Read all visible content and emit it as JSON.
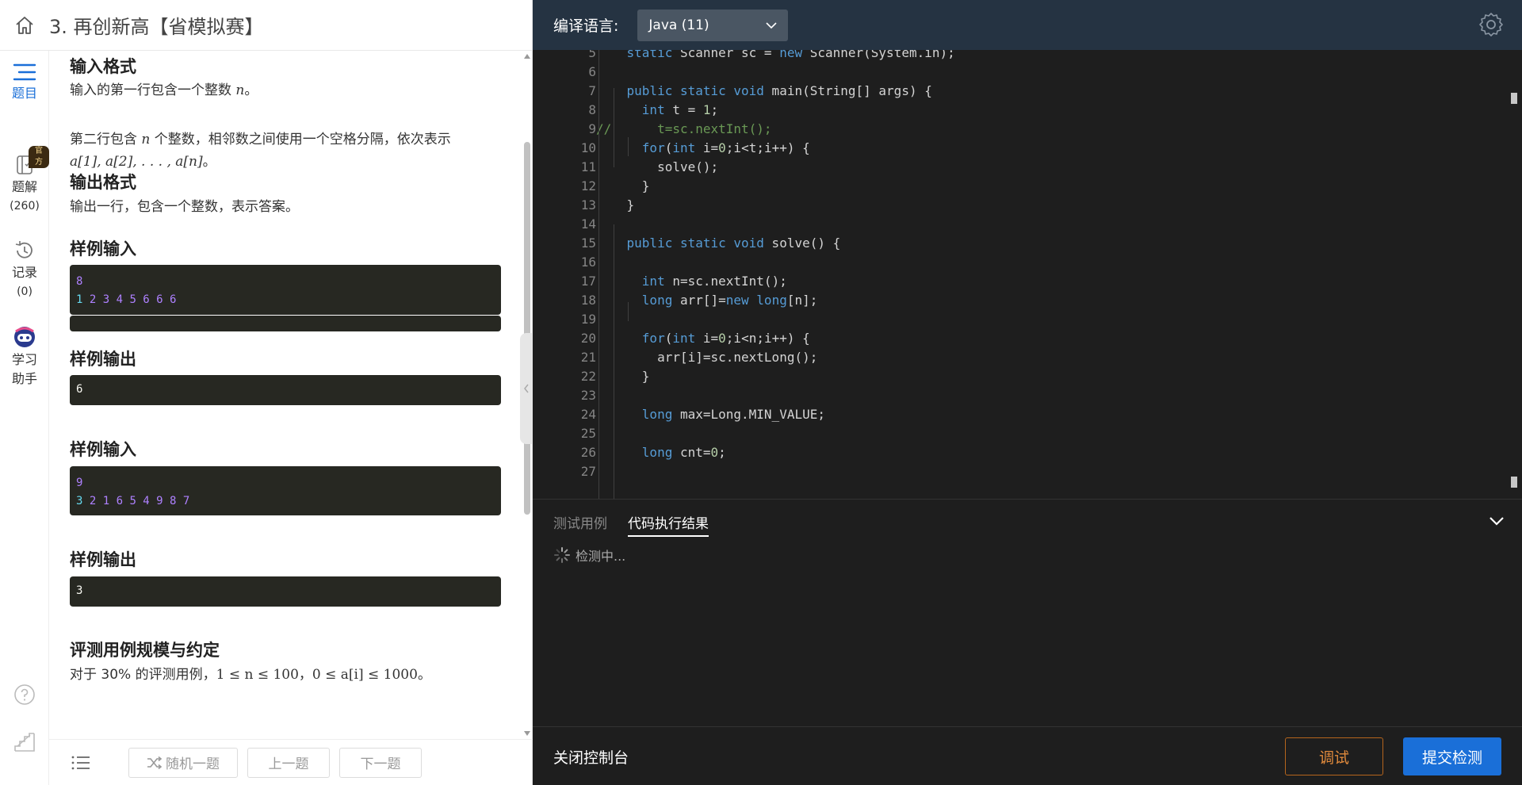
{
  "problem": {
    "title": "3. 再创新高【省模拟赛】"
  },
  "rail": {
    "problem_label": "题目",
    "solutions_label": "题解",
    "solutions_count": "(260)",
    "official_badge": "官方",
    "records_label": "记录",
    "records_count": "(0)",
    "assistant_line1": "学习",
    "assistant_line2": "助手"
  },
  "statement": {
    "input_format_h": "输入格式",
    "input_line1_prefix": "输入的第一行包含一个整数 ",
    "input_line1_var": "n",
    "input_line1_suffix": "。",
    "input_line2_prefix": "第二行包含 ",
    "input_line2_var": "n",
    "input_line2_suffix": " 个整数，相邻数之间使用一个空格分隔，依次表示",
    "input_line2_math": "a[1], a[2], . . . , a[n]",
    "input_line2_end": "。",
    "output_format_h": "输出格式",
    "output_text": "输出一行，包含一个整数，表示答案。",
    "sample_input_h": "样例输入",
    "sample_output_h": "样例输出",
    "samples": [
      {
        "input_l1": "8",
        "input_l2_first": "1",
        "input_l2_rest": " 2 3 4 5 6 6 6",
        "output": "6"
      },
      {
        "input_l1": "9",
        "input_l2_first": "3",
        "input_l2_rest": " 2 1 6 5 4 9 8 7",
        "output": "3"
      }
    ],
    "constraints_h": "评测用例规模与约定",
    "constraints_prefix": "对于 30% 的评测用例，",
    "constraints_math1": "1 ≤ n ≤ 100",
    "constraints_sep": "，",
    "constraints_math2": "0 ≤ a[i] ≤ 1000",
    "constraints_end": "。"
  },
  "footer": {
    "random_btn": "随机一题",
    "prev_btn": "上一题",
    "next_btn": "下一题"
  },
  "editor": {
    "lang_label": "编译语言:",
    "lang_value": "Java (11)",
    "lines": [
      {
        "n": "5",
        "html": "    <span class=\"kw\">static</span> Scanner sc = <span class=\"kw\">new</span> Scanner(System.in);"
      },
      {
        "n": "6",
        "html": ""
      },
      {
        "n": "7",
        "html": "    <span class=\"kw\">public static void</span> main(String[] args) {"
      },
      {
        "n": "8",
        "html": "      <span class=\"kw\">int</span> t = <span class=\"num\">1</span>;"
      },
      {
        "n": "9",
        "html": "<span class=\"cm\">//      t=sc.nextInt();</span>"
      },
      {
        "n": "10",
        "html": "      <span class=\"kw\">for</span>(<span class=\"kw\">int</span> i=<span class=\"num\">0</span>;i&lt;t;i++) {"
      },
      {
        "n": "11",
        "html": "        solve();"
      },
      {
        "n": "12",
        "html": "      }"
      },
      {
        "n": "13",
        "html": "    }"
      },
      {
        "n": "14",
        "html": ""
      },
      {
        "n": "15",
        "html": "    <span class=\"kw\">public static void</span> solve() {"
      },
      {
        "n": "16",
        "html": ""
      },
      {
        "n": "17",
        "html": "      <span class=\"kw\">int</span> n=sc.nextInt();"
      },
      {
        "n": "18",
        "html": "      <span class=\"kw\">long</span> arr[]=<span class=\"kw\">new long</span>[n];"
      },
      {
        "n": "19",
        "html": ""
      },
      {
        "n": "20",
        "html": "      <span class=\"kw\">for</span>(<span class=\"kw\">int</span> i=<span class=\"num\">0</span>;i&lt;n;i++) {"
      },
      {
        "n": "21",
        "html": "        arr[i]=sc.nextLong();"
      },
      {
        "n": "22",
        "html": "      }"
      },
      {
        "n": "23",
        "html": ""
      },
      {
        "n": "24",
        "html": "      <span class=\"kw\">long</span> max=Long.MIN_VALUE;"
      },
      {
        "n": "25",
        "html": ""
      },
      {
        "n": "26",
        "html": "      <span class=\"kw\">long</span> cnt=<span class=\"num\">0</span>;"
      },
      {
        "n": "27",
        "html": ""
      }
    ]
  },
  "console": {
    "tab_testcase": "测试用例",
    "tab_result": "代码执行结果",
    "status_text": "检测中..."
  },
  "actions": {
    "close_console": "关闭控制台",
    "debug": "调试",
    "submit": "提交检测"
  },
  "colors": {
    "accent": "#1a6fd8",
    "header_bg": "#253342",
    "editor_bg": "#1e1e1e",
    "debug_border": "#b5651d"
  }
}
